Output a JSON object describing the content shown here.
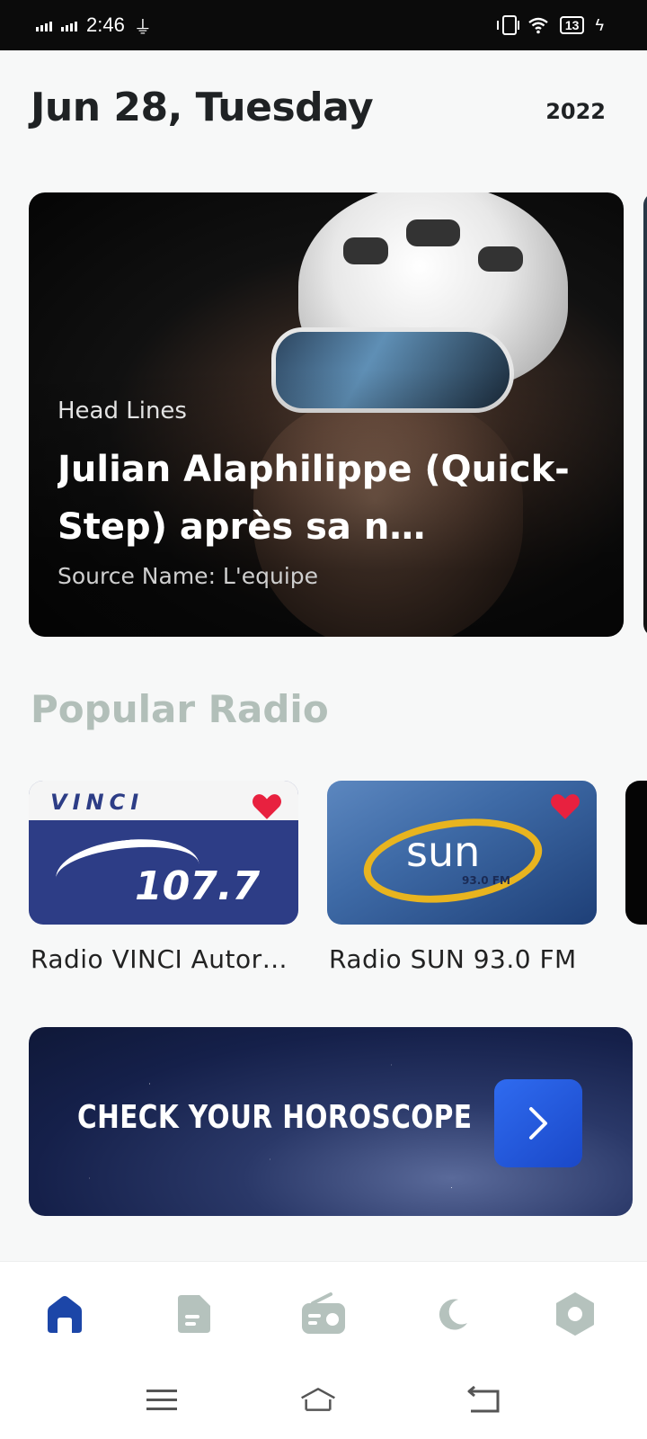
{
  "status_bar": {
    "time": "2:46",
    "battery": "13"
  },
  "header": {
    "date": "Jun 28, Tuesday",
    "year": "2022"
  },
  "headline": {
    "label": "Head Lines",
    "title": "Julian Alaphilippe (Quick-Step) après sa n…",
    "source": "Source Name: L'equipe"
  },
  "popular_radio": {
    "title": "Popular Radio",
    "stations": [
      {
        "name": "Radio VINCI Autor…",
        "logo_text": "VINCI",
        "freq_text": "107.7",
        "favorite": true
      },
      {
        "name": "Radio SUN 93.0 FM",
        "logo_text": "sun",
        "freq_text": "93.0 FM",
        "favorite": true
      }
    ]
  },
  "horoscope": {
    "label": "CHECK YOUR HOROSCOPE"
  },
  "bottom_nav": {
    "items": [
      {
        "icon": "home-icon",
        "active": true
      },
      {
        "icon": "document-icon",
        "active": false
      },
      {
        "icon": "radio-icon",
        "active": false
      },
      {
        "icon": "moon-icon",
        "active": false
      },
      {
        "icon": "settings-icon",
        "active": false
      }
    ]
  },
  "colors": {
    "accent": "#1a48c8",
    "nav_active": "#1c46a8",
    "nav_inactive": "#b5c2bd",
    "favorite": "#e8213f",
    "section_title": "#b2bfb9"
  }
}
